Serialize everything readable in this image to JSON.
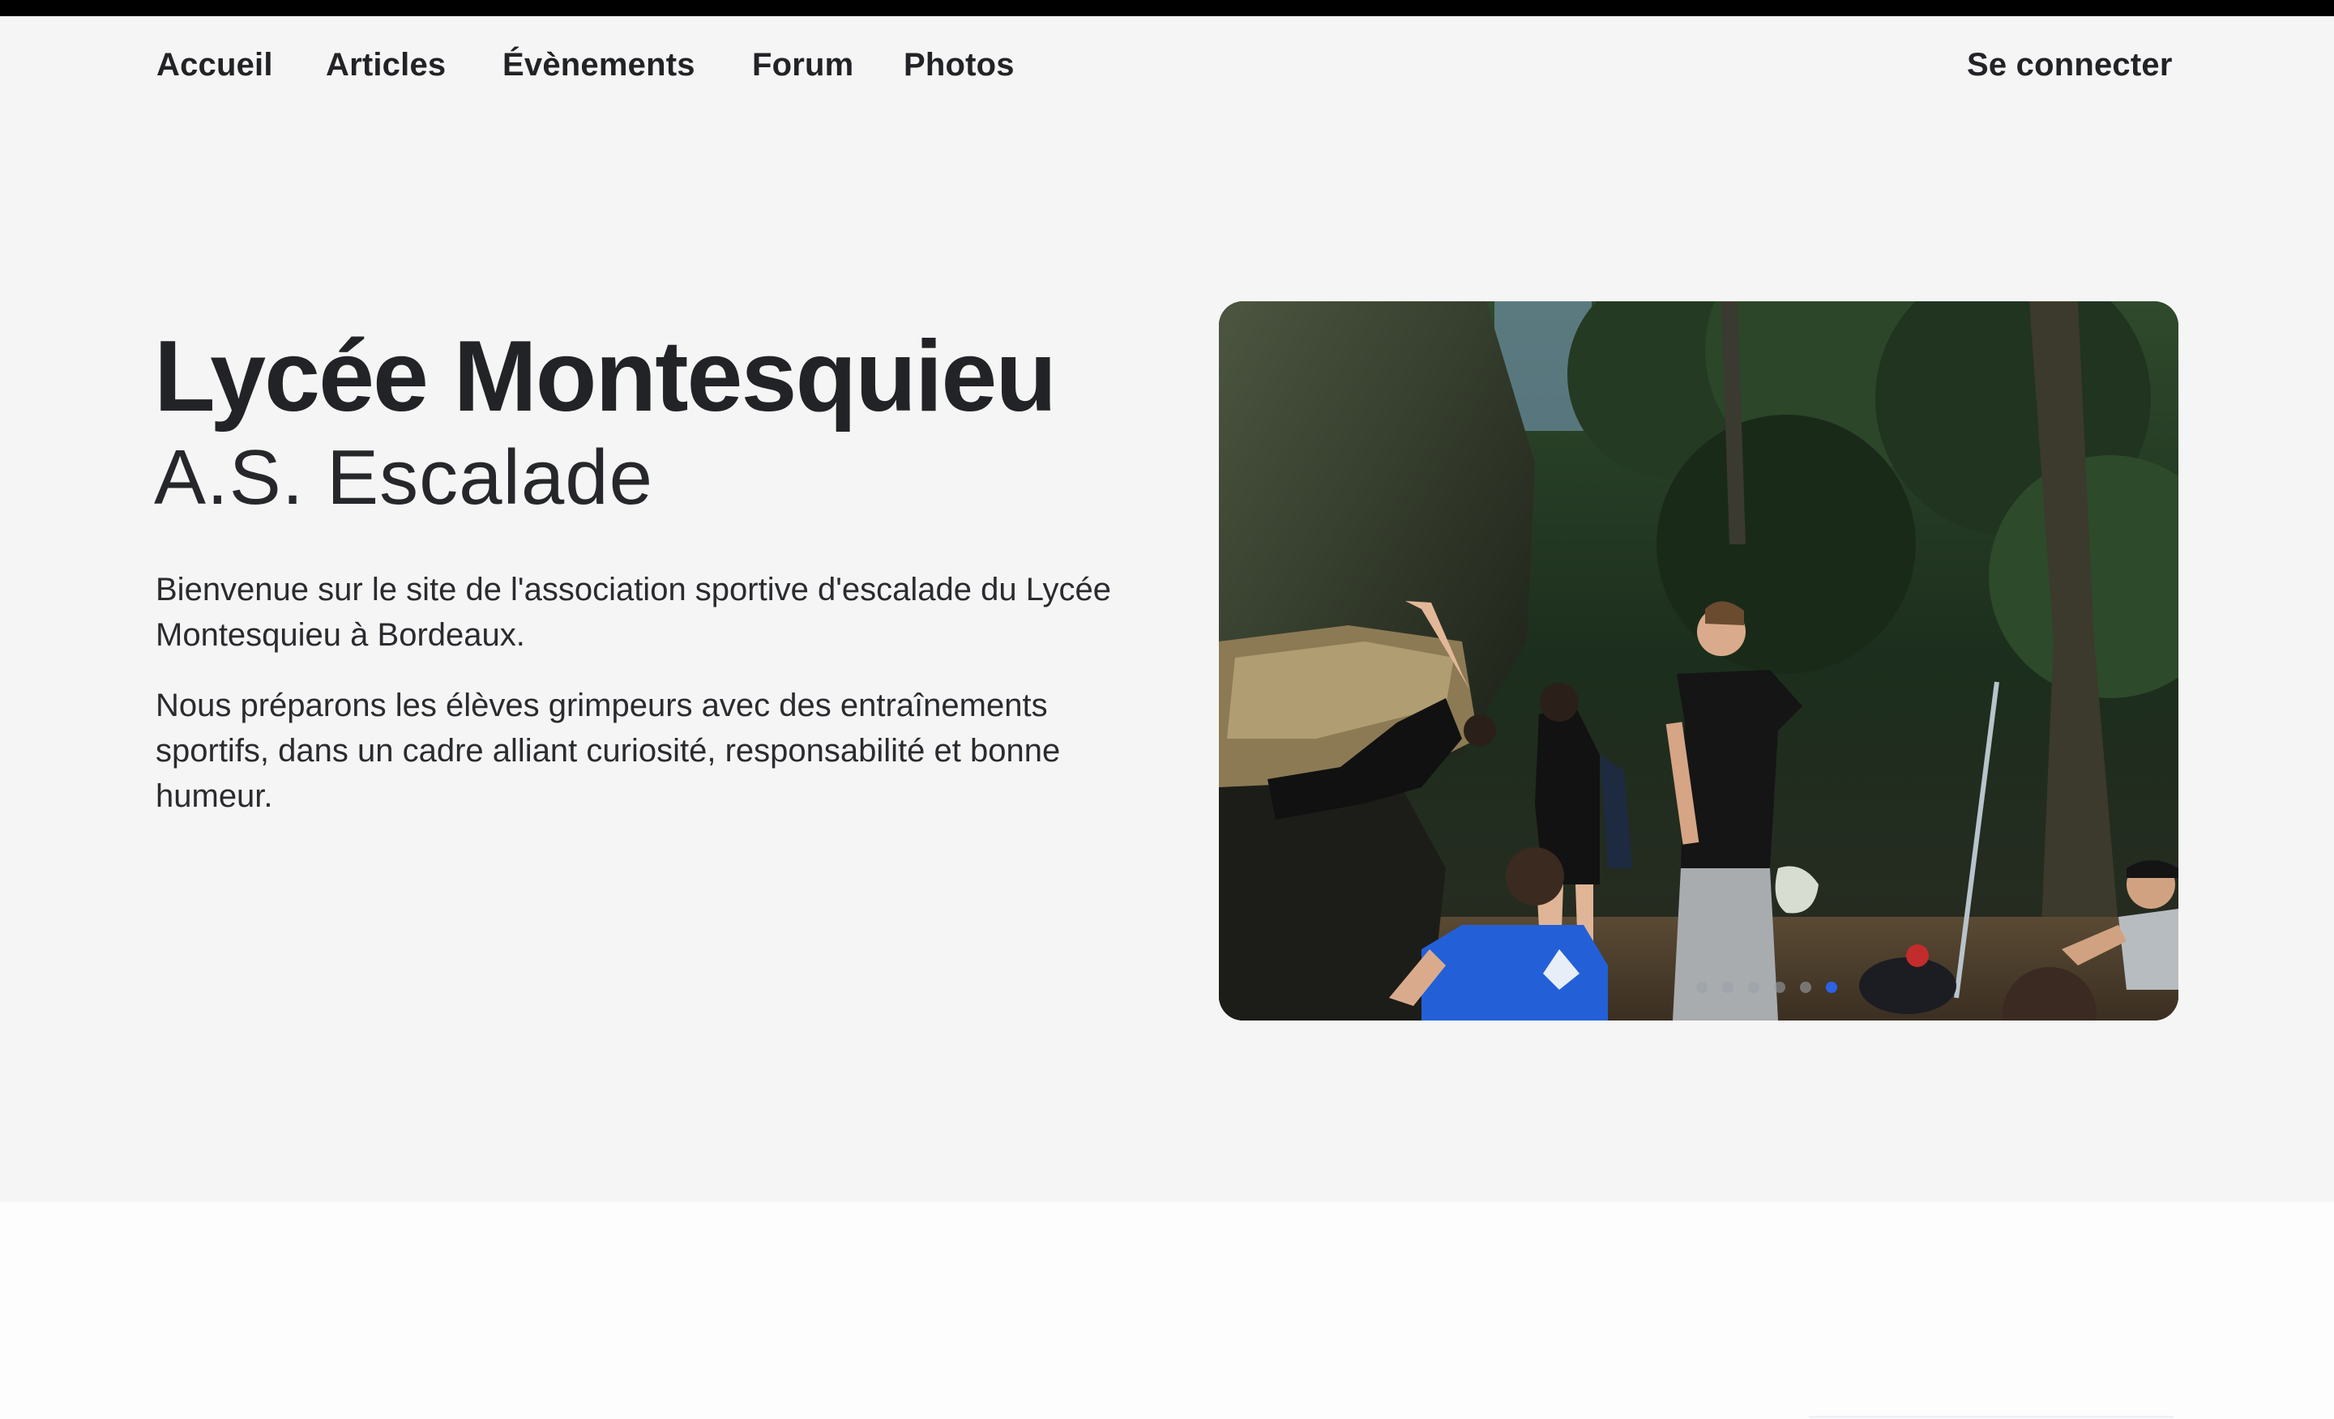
{
  "nav": {
    "items": [
      {
        "label": "Accueil"
      },
      {
        "label": "Articles"
      },
      {
        "label": "Évènements"
      },
      {
        "label": "Forum"
      },
      {
        "label": "Photos"
      }
    ],
    "login_label": "Se connecter"
  },
  "hero": {
    "title": "Lycée Montesquieu",
    "subtitle": "A.S. Escalade",
    "paragraph1": "Bienvenue sur le site de l'association sportive d'escalade du Lycée Montesquieu à Bordeaux.",
    "paragraph2": "Nous préparons les élèves grimpeurs avec des entraînements sportifs, dans un cadre alliant curiosité, responsabilité et bonne humeur."
  },
  "carousel": {
    "slide_count": 6,
    "active_index": 5,
    "colors": {
      "dot_inactive": "#9aa0a6",
      "dot_active": "#2b62e6"
    }
  }
}
